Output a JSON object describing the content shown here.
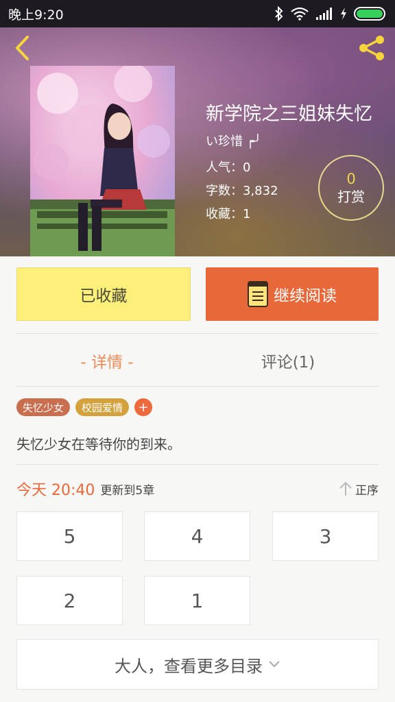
{
  "status_bar": {
    "time": "晚上9:20"
  },
  "book": {
    "title": "新学院之三姐妹失忆",
    "author": "い珍惜 ┍╯",
    "popularity": "人气：0",
    "word_count": "字数：3,832",
    "favorites": "收藏：1"
  },
  "reward": {
    "count": "0",
    "label": "打赏"
  },
  "actions": {
    "favorited_label": "已收藏",
    "read_label": "继续阅读"
  },
  "tabs": [
    {
      "label": "- 详情 -"
    },
    {
      "label": "评论(1)"
    }
  ],
  "tags": [
    {
      "label": "失忆少女",
      "color": "#c96f4f"
    },
    {
      "label": "校园爱情",
      "color": "#d3a23c"
    }
  ],
  "tag_add_label": "+",
  "description": "失忆少女在等待你的到来。",
  "update": {
    "time": "今天 20:40",
    "text": "更新到5章",
    "sort_label": "正序"
  },
  "chapters": [
    "5",
    "4",
    "3",
    "2",
    "1"
  ],
  "more_catalog_label": "大人，查看更多目录",
  "colors": {
    "accent": "#e8683a",
    "favorite_bg": "#fcf07a",
    "status_bar_bg": "#1d1a22"
  }
}
